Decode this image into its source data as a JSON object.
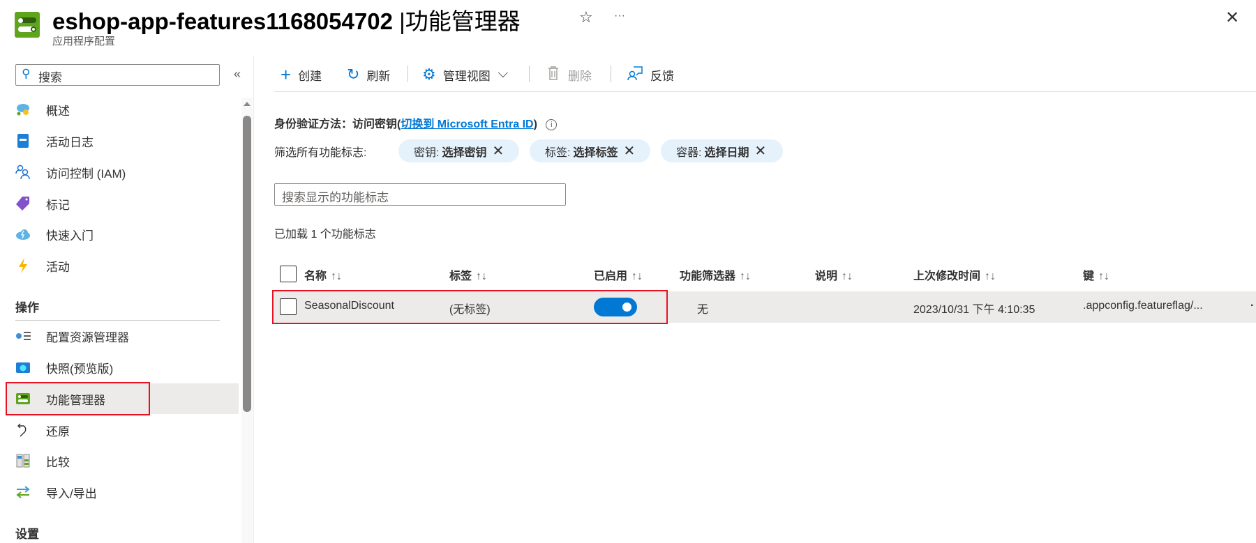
{
  "header": {
    "resource_name": "eshop-app-features1168054702",
    "separator": "|",
    "page_name": "功能管理器",
    "subtitle": "应用程序配置",
    "favorite_glyph": "☆",
    "more_glyph": "···",
    "close_glyph": "✕"
  },
  "sidebar": {
    "search_placeholder": "搜索",
    "collapse_glyph": "«",
    "items": [
      {
        "label": "概述",
        "icon": "overview-icon"
      },
      {
        "label": "活动日志",
        "icon": "activity-log-icon"
      },
      {
        "label": "访问控制 (IAM)",
        "icon": "iam-icon"
      },
      {
        "label": "标记",
        "icon": "tag-icon"
      },
      {
        "label": "快速入门",
        "icon": "quickstart-icon"
      },
      {
        "label": "活动",
        "icon": "events-icon"
      }
    ],
    "section_operations": "操作",
    "operations": [
      {
        "label": "配置资源管理器",
        "icon": "config-explorer-icon"
      },
      {
        "label": "快照(预览版)",
        "icon": "snapshot-icon"
      },
      {
        "label": "功能管理器",
        "icon": "feature-manager-icon",
        "selected": true
      },
      {
        "label": "还原",
        "icon": "restore-icon"
      },
      {
        "label": "比较",
        "icon": "compare-icon"
      },
      {
        "label": "导入/导出",
        "icon": "import-export-icon"
      }
    ],
    "section_settings": "设置"
  },
  "toolbar": {
    "create": "创建",
    "refresh": "刷新",
    "manage_view": "管理视图",
    "delete": "删除",
    "feedback": "反馈"
  },
  "auth": {
    "label": "身份验证方法：访问密钥(",
    "link": "切换到 Microsoft Entra ID",
    "close_paren": ")"
  },
  "filters": {
    "label": "筛选所有功能标志:",
    "pills": [
      {
        "key": "密钥:",
        "value": "选择密钥"
      },
      {
        "key": "标签:",
        "value": "选择标签"
      },
      {
        "key": "容器:",
        "value": "选择日期"
      }
    ]
  },
  "search": {
    "placeholder": "搜索显示的功能标志"
  },
  "status": "已加载 1 个功能标志",
  "table": {
    "sort_glyph": "↑↓",
    "columns": [
      "名称",
      "标签",
      "已启用",
      "功能筛选器",
      "说明",
      "上次修改时间",
      "键"
    ],
    "rows": [
      {
        "name": "SeasonalDiscount",
        "label": "(无标签)",
        "enabled": true,
        "filters": "无",
        "description": "",
        "modified": "2023/10/31 下午 4:10:35",
        "key": ".appconfig.featureflag/...",
        "more": "·"
      }
    ]
  },
  "colors": {
    "accent": "#0078d4",
    "highlight": "#e81123",
    "selected_bg": "#edebe9"
  }
}
